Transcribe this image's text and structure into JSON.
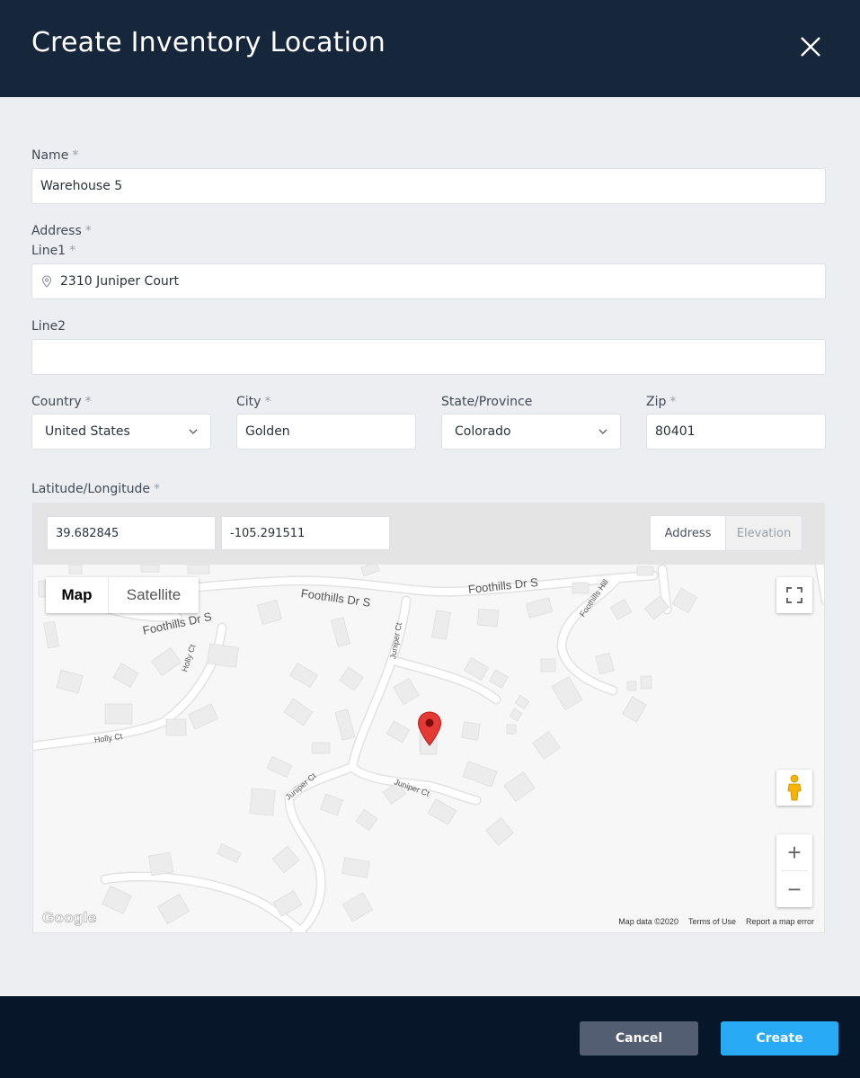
{
  "dialog": {
    "title": "Create Inventory Location",
    "close_icon": "close-icon"
  },
  "form": {
    "required_marker": "*",
    "name": {
      "label": "Name",
      "value": "Warehouse 5"
    },
    "address": {
      "label": "Address",
      "line1": {
        "label": "Line1",
        "value": "2310 Juniper Court",
        "icon": "location-pin-icon"
      },
      "line2": {
        "label": "Line2",
        "value": ""
      },
      "country": {
        "label": "Country",
        "value": "United States"
      },
      "city": {
        "label": "City",
        "value": "Golden"
      },
      "state": {
        "label": "State/Province",
        "value": "Colorado"
      },
      "zip": {
        "label": "Zip",
        "value": "80401"
      }
    },
    "latlng": {
      "label": "Latitude/Longitude",
      "latitude": "39.682845",
      "longitude": "-105.291511",
      "modes": [
        "Address",
        "Elevation"
      ],
      "active_mode": "Address"
    }
  },
  "map": {
    "type_buttons": {
      "map": "Map",
      "satellite": "Satellite"
    },
    "selected_type": "Map",
    "zoom_in": "+",
    "zoom_out": "−",
    "streets": [
      "Foothills Dr S",
      "Foothills Dr S",
      "Foothills Dr S",
      "Foothills Hill",
      "Juniper Ct",
      "Juniper Ct",
      "Juniper Ct",
      "Holly Ct",
      "Holly Ct"
    ],
    "attribution": {
      "data": "Map data ©2020",
      "terms": "Terms of Use",
      "report": "Report a map error"
    },
    "logo": "Google",
    "marker_color": "#e53935"
  },
  "footer": {
    "cancel": "Cancel",
    "create": "Create"
  },
  "colors": {
    "header": "#16263b",
    "footer": "#081629",
    "primary": "#29aaf5",
    "secondary": "#545e72"
  }
}
